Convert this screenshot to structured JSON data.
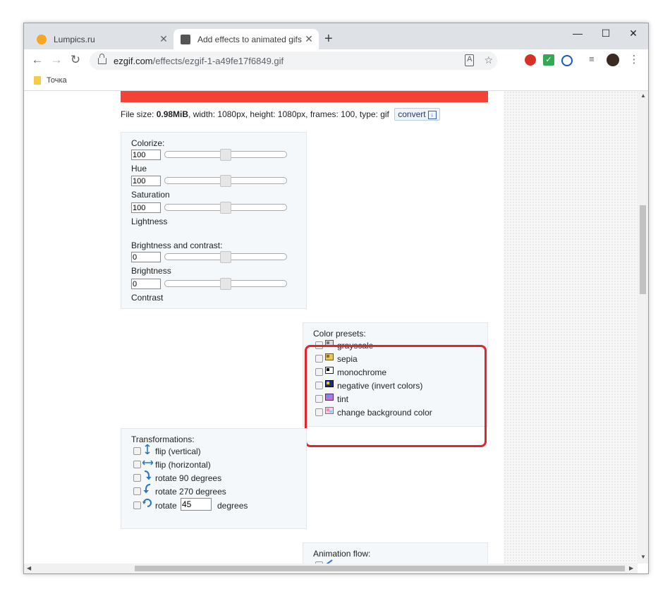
{
  "browser": {
    "tabs": [
      {
        "title": "Lumpics.ru",
        "active": false,
        "favicon_color": "#f5a623"
      },
      {
        "title": "Add effects to animated gifs - gif",
        "active": true,
        "favicon_color": "#555555"
      }
    ],
    "new_tab_symbol": "+",
    "window_controls": {
      "minimize": "—",
      "maximize": "☐",
      "close": "✕"
    },
    "nav": {
      "back": "←",
      "forward": "→",
      "reload": "↻"
    },
    "url_host": "ezgif.com",
    "url_path": "/effects/ezgif-1-a49fe17f6849.gif",
    "bookmark": "Точка"
  },
  "page": {
    "accent_red": "#f44336",
    "fileinfo": {
      "prefix": "File size: ",
      "size": "0.98MiB",
      "rest": ", width: 1080px, height: 1080px, frames: 100, type: gif",
      "convert": "convert"
    },
    "colorize": {
      "title": "Colorize:",
      "fields": [
        {
          "value": "100",
          "label": "Hue",
          "level": 0.5
        },
        {
          "value": "100",
          "label": "Saturation",
          "level": 0.5
        },
        {
          "value": "100",
          "label": "Lightness",
          "level": 0.5
        }
      ]
    },
    "brightness": {
      "title": "Brightness and contrast:",
      "fields": [
        {
          "value": "0",
          "label": "Brightness",
          "level": 0.5
        },
        {
          "value": "0",
          "label": "Contrast",
          "level": 0.5
        }
      ]
    },
    "presets": {
      "title": "Color presets:",
      "items": [
        "grayscale",
        "sepia",
        "monochrome",
        "negative (invert colors)",
        "tint",
        "change background color"
      ]
    },
    "transformations": {
      "title": "Transformations:",
      "items": [
        "flip (vertical)",
        "flip (horizontal)",
        "rotate 90 degrees",
        "rotate 270 degrees"
      ],
      "rotate_label": "rotate",
      "rotate_value": "45",
      "rotate_unit": "degrees"
    },
    "animation_flow": {
      "title": "Animation flow:"
    }
  }
}
